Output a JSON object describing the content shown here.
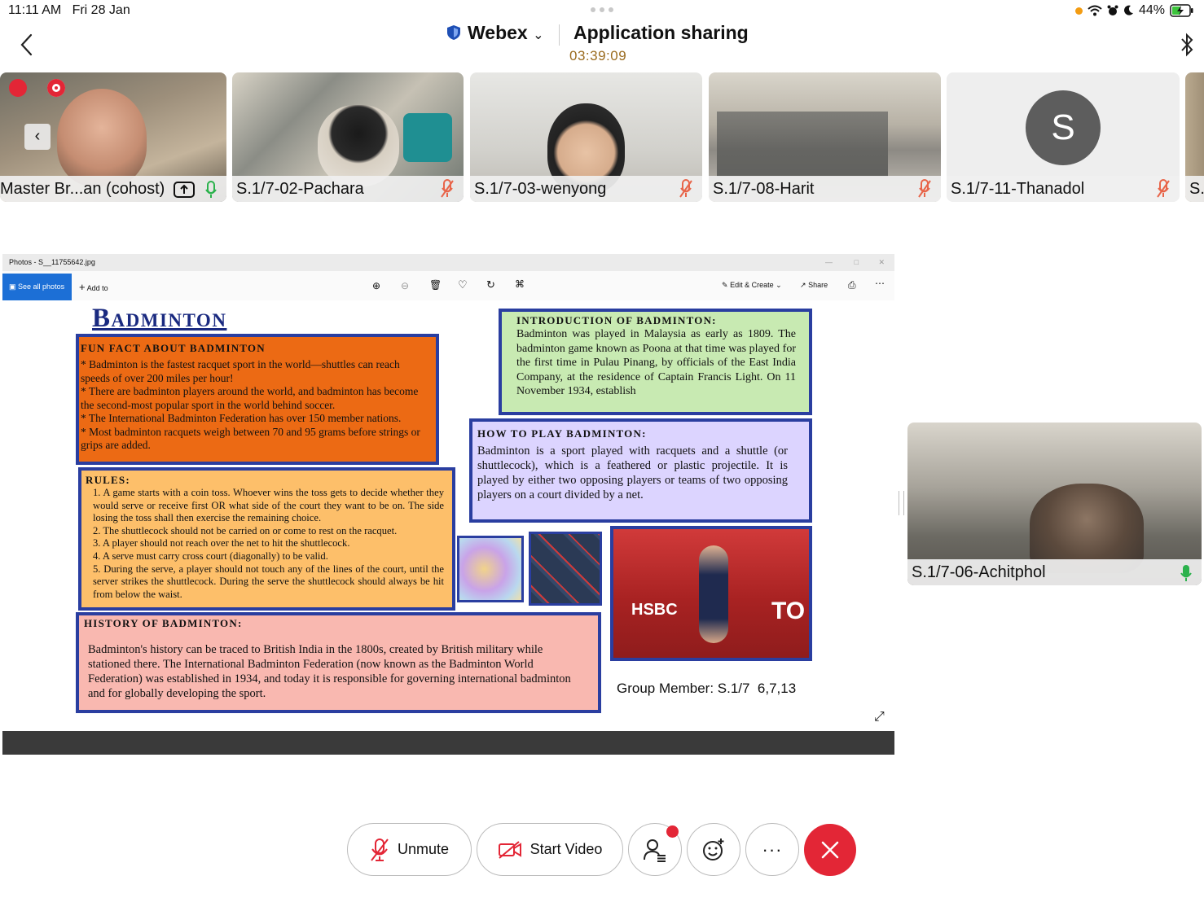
{
  "status": {
    "time": "11:11 AM",
    "date": "Fri 28 Jan",
    "battery": "44%"
  },
  "header": {
    "app": "Webex",
    "title": "Application sharing",
    "timer": "03:39:09"
  },
  "participants": [
    {
      "name": "Master Br...an (cohost)"
    },
    {
      "name": "S.1/7-02-Pachara"
    },
    {
      "name": "S.1/7-03-wenyong"
    },
    {
      "name": "S.1/7-08-Harit"
    },
    {
      "name": "S.1/7-11-Thanadol",
      "initial": "S"
    },
    {
      "name": "S."
    }
  ],
  "active_speaker": {
    "name": "S.1/7-06-Achitphol"
  },
  "photos_window": {
    "title": "Photos - S__11755642.jpg",
    "see_all": "See all photos",
    "add_to": "Add to",
    "edit_create": "Edit & Create",
    "share": "Share"
  },
  "slide": {
    "title": "Badminton",
    "fun_fact": {
      "heading": "Fun fact about Badminton",
      "lines": [
        "* Badminton is the fastest racquet sport in the world—shuttles can reach speeds of over 200 miles per hour!",
        "* There are badminton players around the world, and badminton has become the second-most popular sport in the world behind soccer.",
        "* The International Badminton Federation has over 150 member nations.",
        "* Most badminton racquets weigh between 70 and 95 grams before strings or grips are added."
      ]
    },
    "intro": {
      "heading": "Introduction of Badminton:",
      "text": "Badminton was played in Malaysia as early as 1809. The badminton game known as Poona at that time was played for the first time in Pulau Pinang, by officials of the East India Company, at the residence of Captain Francis Light. On 11 November 1934, establish"
    },
    "how_to": {
      "heading": "How to play Badminton:",
      "text": "Badminton is a sport played with racquets and a shuttle (or shuttlecock), which is a feathered or plastic projectile. It is played by either two opposing players or teams of two opposing players on a court divided by a net."
    },
    "rules": {
      "heading": "Rules:",
      "lines": [
        "1. A game starts with a coin toss. Whoever wins the toss gets to decide whether they would serve or receive first OR what side of the court they want to be on. The side losing the toss shall then exercise the remaining choice.",
        "2. The shuttlecock should not be carried on or come to rest on the racquet.",
        "3. A player should not reach over the net to hit the shuttlecock.",
        "4. A serve must carry cross court (diagonally) to be valid.",
        "5. During the serve, a player should not touch any of the lines of the court, until the server strikes the shuttlecock. During the serve the shuttlecock should always be hit from below the waist."
      ]
    },
    "history": {
      "heading": "History of Badminton:",
      "text": "Badminton's history can be traced to British India in the 1800s, created by British military while stationed there. The International Badminton Federation (now known as the Badminton World Federation) was established in 1934, and today it is responsible for governing international badminton and for globally developing the sport."
    },
    "photo_banner_left": "HSBC",
    "photo_banner_right": "TO",
    "group_member": "Group Member: S.1/7  6,7,13"
  },
  "controls": {
    "unmute": "Unmute",
    "start_video": "Start Video",
    "more": "···"
  },
  "colors": {
    "accent_red": "#e32636",
    "box_border": "#2a3ea0",
    "orange": "#ec6a14",
    "green": "#c8eab2",
    "lavender": "#dcd4ff",
    "peach": "#fdbf6a",
    "pink": "#f9b8b0"
  }
}
